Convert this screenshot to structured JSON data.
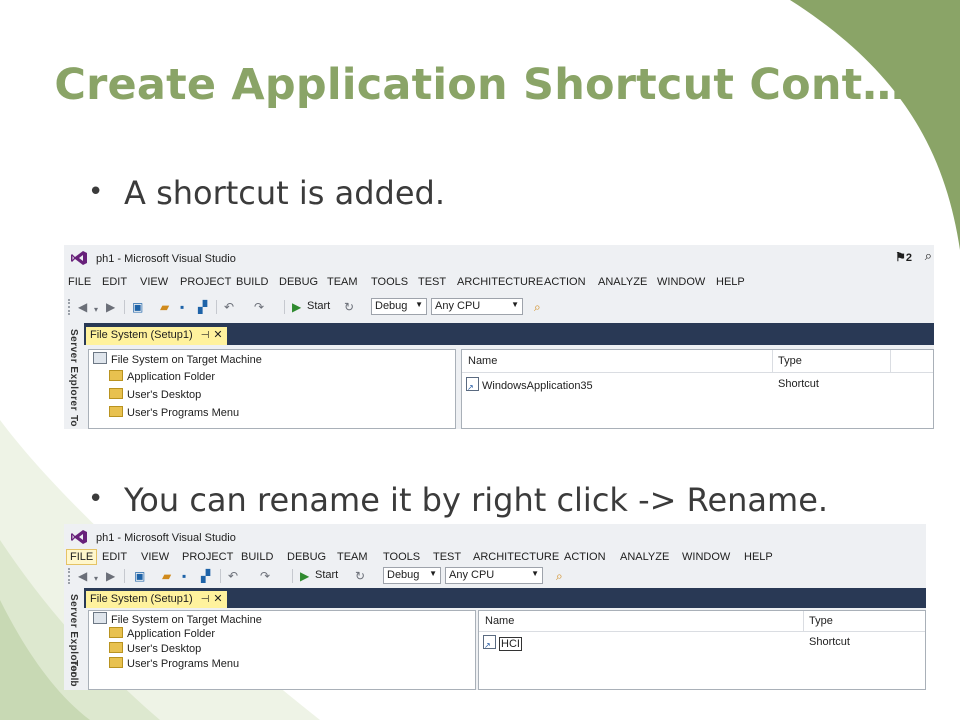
{
  "slide": {
    "title": "Create Application Shortcut Cont…",
    "bullet1": "A shortcut is added.",
    "bullet2": "You can rename it by right click -> Rename.",
    "bullet_char": "•",
    "accent_color": "#8aa467"
  },
  "screenshot1": {
    "window_title": "ph1 - Microsoft Visual Studio",
    "notification_count": "2",
    "menu": [
      "FILE",
      "EDIT",
      "VIEW",
      "PROJECT",
      "BUILD",
      "DEBUG",
      "TEAM",
      "TOOLS",
      "TEST",
      "ARCHITECTURE",
      "ACTION",
      "ANALYZE",
      "WINDOW",
      "HELP"
    ],
    "toolbar": {
      "start_label": "Start",
      "config": "Debug",
      "platform": "Any CPU"
    },
    "sidebar_label": "Server Explorer",
    "sidebar_label2": "To",
    "tab_label": "File System (Setup1)",
    "tab_pin": "⊣",
    "tab_close": "✕",
    "tree": [
      "File System on Target Machine",
      "Application Folder",
      "User's Desktop",
      "User's Programs Menu"
    ],
    "list_headers": {
      "name": "Name",
      "type": "Type"
    },
    "list_rows": [
      {
        "name": "WindowsApplication35",
        "type": "Shortcut"
      }
    ]
  },
  "screenshot2": {
    "window_title": "ph1 - Microsoft Visual Studio",
    "menu": [
      "FILE",
      "EDIT",
      "VIEW",
      "PROJECT",
      "BUILD",
      "DEBUG",
      "TEAM",
      "TOOLS",
      "TEST",
      "ARCHITECTURE",
      "ACTION",
      "ANALYZE",
      "WINDOW",
      "HELP"
    ],
    "active_menu": "FILE",
    "toolbar": {
      "start_label": "Start",
      "config": "Debug",
      "platform": "Any CPU"
    },
    "sidebar_label": "Server Explorer",
    "sidebar_label2": "Toolb",
    "tab_label": "File System (Setup1)",
    "tab_pin": "⊣",
    "tab_close": "✕",
    "tree": [
      "File System on Target Machine",
      "Application Folder",
      "User's Desktop",
      "User's Programs Menu"
    ],
    "list_headers": {
      "name": "Name",
      "type": "Type"
    },
    "list_rows": [
      {
        "name": "HCI",
        "type": "Shortcut"
      }
    ]
  }
}
